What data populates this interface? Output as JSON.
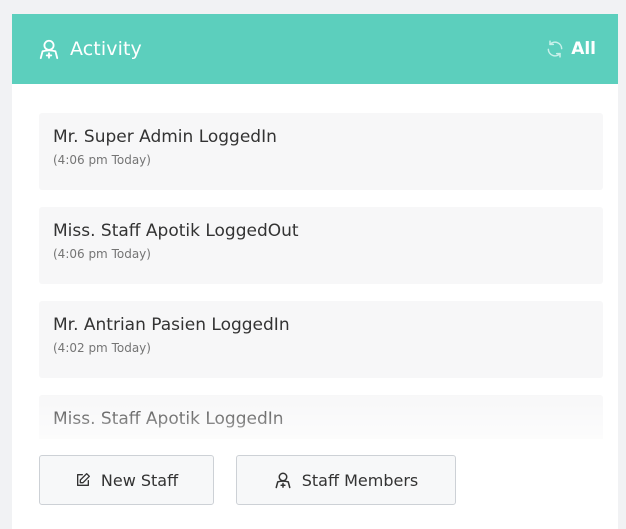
{
  "header": {
    "title": "Activity",
    "title_icon": "user-icon",
    "refresh_icon": "refresh-icon",
    "refresh_label": "All",
    "color": "#5ccfbd"
  },
  "activities": [
    {
      "text": "Mr. Super Admin LoggedIn",
      "time": "(4:06 pm Today)"
    },
    {
      "text": "Miss. Staff Apotik LoggedOut",
      "time": "(4:06 pm Today)"
    },
    {
      "text": "Mr. Antrian Pasien LoggedIn",
      "time": "(4:02 pm Today)"
    },
    {
      "text": "Miss. Staff Apotik LoggedIn",
      "time": ""
    }
  ],
  "footer": {
    "new_staff_label": "New Staff",
    "new_staff_icon": "edit-icon",
    "staff_members_label": "Staff Members",
    "staff_members_icon": "user-icon"
  }
}
